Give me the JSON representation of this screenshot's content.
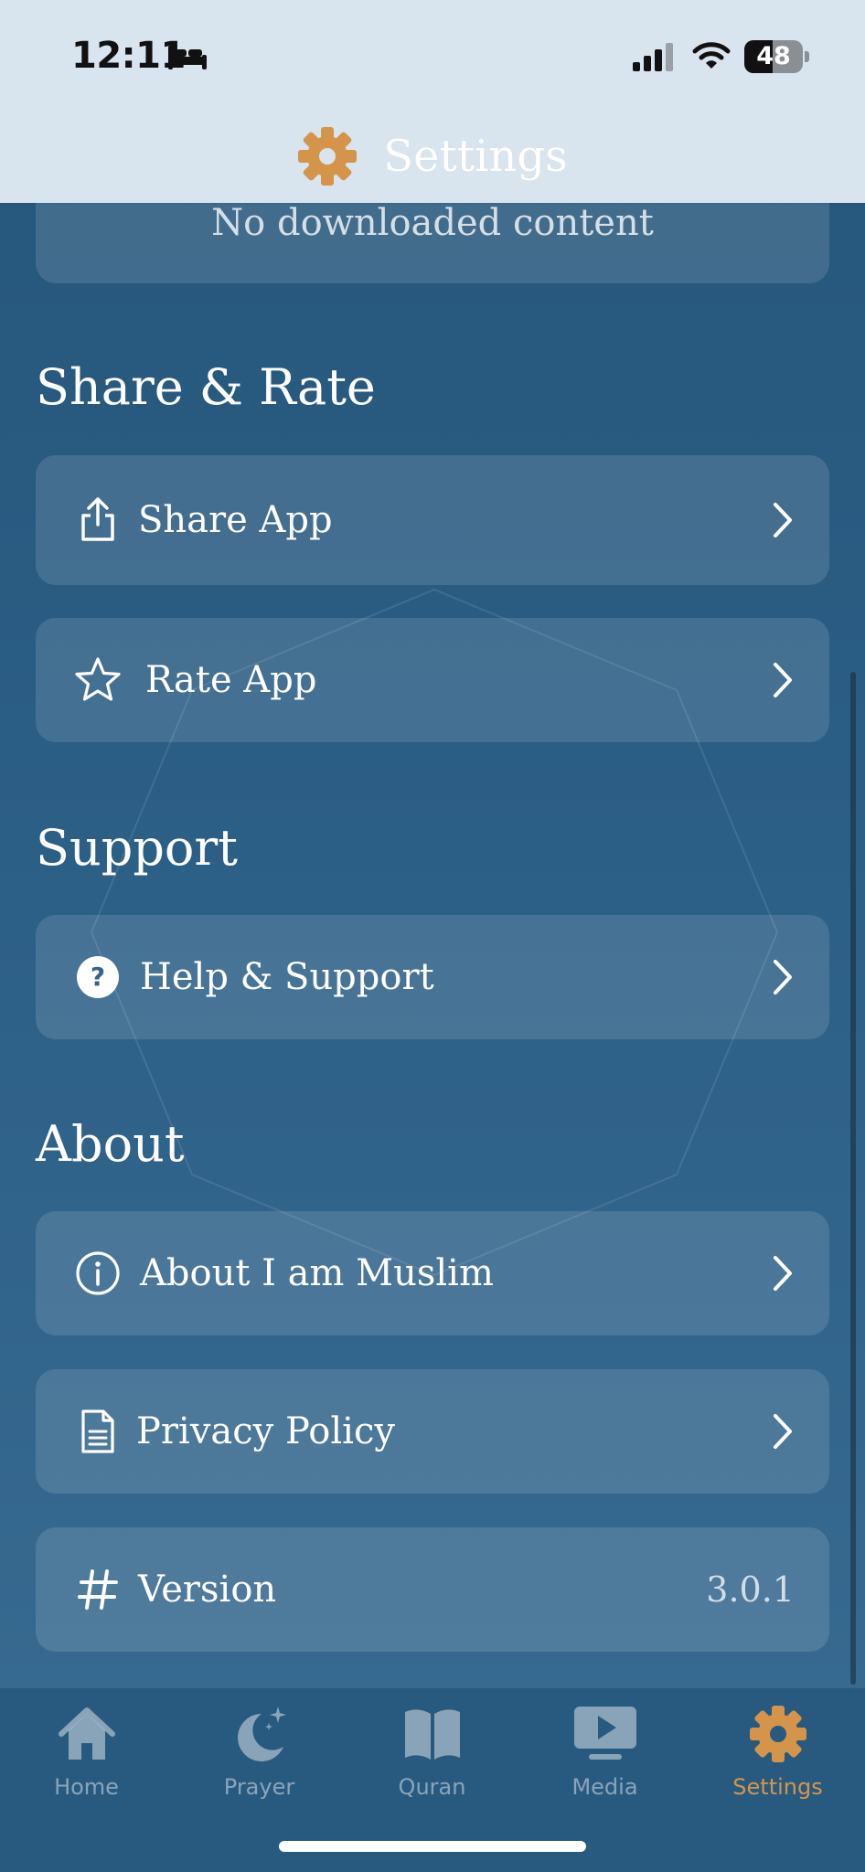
{
  "status_bar": {
    "time": "12:11",
    "battery_level": "48",
    "battery_fraction": 0.48,
    "icons": [
      "bed-icon",
      "cellular-signal-icon",
      "wifi-icon",
      "battery-icon"
    ]
  },
  "header": {
    "title": "Settings",
    "icon": "gear-icon",
    "icon_color": "#d4954a"
  },
  "downloads": {
    "empty_text": "No downloaded content"
  },
  "sections": {
    "share_rate": {
      "title": "Share & Rate",
      "share_app": {
        "label": "Share App",
        "icon": "share-icon"
      },
      "rate_app": {
        "label": "Rate App",
        "icon": "star-icon"
      }
    },
    "support": {
      "title": "Support",
      "help_support": {
        "label": "Help & Support",
        "icon": "question-circle-icon"
      }
    },
    "about": {
      "title": "About",
      "about_app": {
        "label": "About I am Muslim",
        "icon": "info-circle-icon"
      },
      "privacy_policy": {
        "label": "Privacy Policy",
        "icon": "document-icon"
      },
      "version": {
        "label": "Version",
        "value": "3.0.1",
        "icon": "hash-icon"
      }
    }
  },
  "tab_bar": {
    "active_color": "#d4954a",
    "tabs": [
      {
        "label": "Home",
        "icon": "home-icon",
        "active": false
      },
      {
        "label": "Prayer",
        "icon": "crescent-moon-icon",
        "active": false
      },
      {
        "label": "Quran",
        "icon": "book-icon",
        "active": false
      },
      {
        "label": "Media",
        "icon": "play-video-icon",
        "active": false
      },
      {
        "label": "Settings",
        "icon": "gear-icon",
        "active": true
      }
    ]
  }
}
